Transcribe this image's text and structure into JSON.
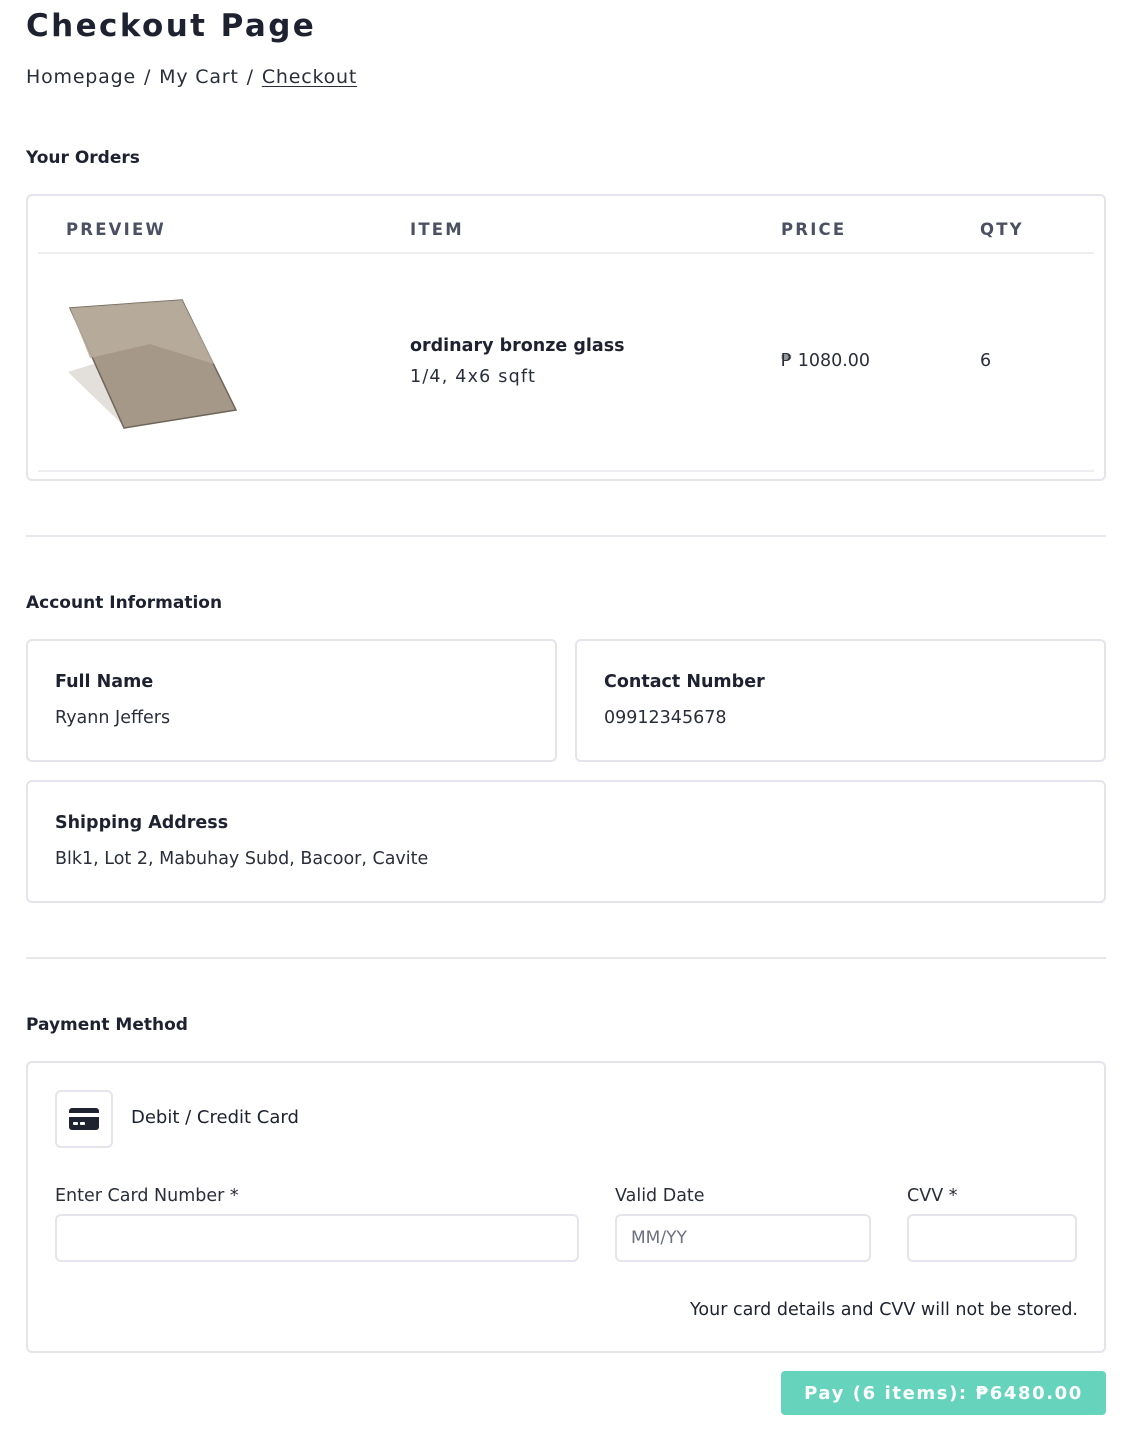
{
  "page_title": "Checkout Page",
  "breadcrumb": {
    "items": [
      "Homepage",
      "My Cart",
      "Checkout"
    ],
    "separator": "/"
  },
  "orders": {
    "section_title": "Your Orders",
    "columns": [
      "PREVIEW",
      "ITEM",
      "PRICE",
      "QTY"
    ],
    "rows": [
      {
        "preview_image": "bronze-glass-pane",
        "name": "ordinary bronze glass",
        "spec": "1/4, 4x6 sqft",
        "price": "₱ 1080.00",
        "qty": "6"
      }
    ]
  },
  "account": {
    "section_title": "Account Information",
    "full_name_label": "Full Name",
    "full_name": "Ryann Jeffers",
    "contact_label": "Contact Number",
    "contact": "09912345678",
    "address_label": "Shipping Address",
    "address": "Blk1, Lot 2, Mabuhay Subd, Bacoor, Cavite"
  },
  "payment": {
    "section_title": "Payment Method",
    "method_icon": "credit-card-icon",
    "method_label": "Debit / Credit Card",
    "card_number_label": "Enter Card Number *",
    "card_number_value": "",
    "valid_date_label": "Valid Date",
    "valid_date_placeholder": "MM/YY",
    "cvv_label": "CVV *",
    "cvv_value": "",
    "notice": "Your card details and CVV will not be stored."
  },
  "pay_button_label": "Pay (6 items): ₱6480.00",
  "colors": {
    "accent": "#66d4bd",
    "border": "#e3e5ea",
    "text": "#1e2230"
  }
}
